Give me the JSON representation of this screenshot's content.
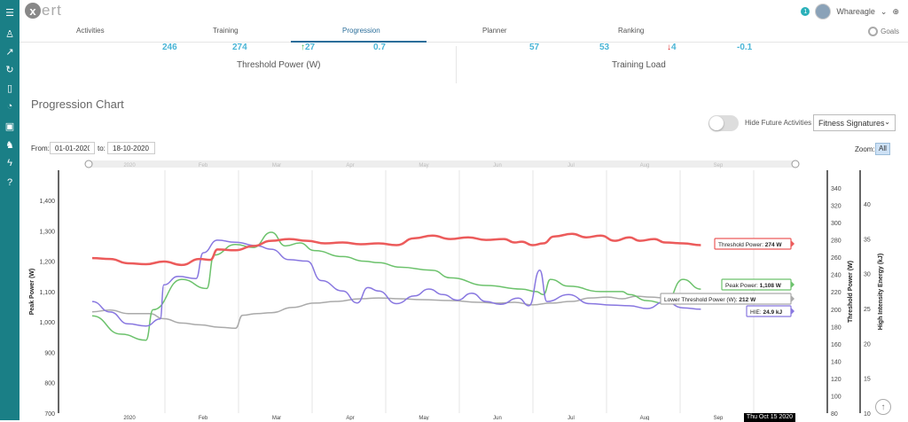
{
  "app": {
    "logo_letter": "x",
    "logo_text": "ert",
    "username": "Whareagle",
    "notifications": "1"
  },
  "sidebar": {
    "icons": [
      "menu-icon",
      "user-icon",
      "chart-icon",
      "refresh-icon",
      "phone-icon",
      "gauge-icon",
      "calendar-icon",
      "group-icon",
      "bolt-icon",
      "help-icon"
    ]
  },
  "tabs": [
    {
      "label": "Activities"
    },
    {
      "label": "Training"
    },
    {
      "label": "Progression"
    },
    {
      "label": "Planner"
    },
    {
      "label": "Ranking"
    }
  ],
  "goals_label": "Goals",
  "stats": {
    "threshold": {
      "values": [
        "246",
        "274",
        "27",
        "0.7"
      ],
      "label": "Threshold Power (W)"
    },
    "load": {
      "values": [
        "57",
        "53",
        "4",
        "-0.1"
      ],
      "label": "Training Load"
    }
  },
  "section_title": "Progression Chart",
  "controls": {
    "hide_future_label": "Hide Future Activities",
    "signature_select": "Fitness Signatures",
    "from_label": "From:",
    "from_value": "01-01-2020",
    "to_label": "to:",
    "to_value": "18-10-2020",
    "zoom_label": "Zoom:",
    "zoom_value": "All"
  },
  "colors": {
    "sidebar": "#1a7f86",
    "accent": "#4ab5d6",
    "threshold": "#ec5b5b",
    "peak": "#6cc26c",
    "lower": "#aaaaaa",
    "hie": "#8877e0"
  },
  "chart_data": {
    "type": "line",
    "x_month_labels": [
      "2020",
      "Feb",
      "Mar",
      "Apr",
      "May",
      "Jun",
      "Jul",
      "Aug",
      "Sep"
    ],
    "navigator_labels": [
      "2020",
      "Feb",
      "Mar",
      "Apr",
      "May",
      "Jun",
      "Jul",
      "Aug",
      "Sep"
    ],
    "y_left": {
      "label": "Peak Power (W)",
      "ticks": [
        "1,400",
        "1,300",
        "1,200",
        "1,100",
        "1,000",
        "900",
        "800",
        "700"
      ],
      "range": [
        700,
        1400
      ]
    },
    "y_right1": {
      "label": "Threshold Power (W)",
      "ticks": [
        "340",
        "320",
        "300",
        "280",
        "260",
        "240",
        "220",
        "200",
        "180",
        "160",
        "140",
        "120",
        "100",
        "80"
      ],
      "range": [
        80,
        340
      ]
    },
    "y_right2": {
      "label": "High Intensity Energy (kJ)",
      "ticks": [
        "40",
        "35",
        "30",
        "25",
        "20",
        "15",
        "10"
      ],
      "range": [
        10,
        40
      ]
    },
    "tooltip_date": "Thu Oct 15 2020",
    "series": [
      {
        "name": "Threshold Power",
        "last_label": "274 W",
        "axis": "right1",
        "points": [
          [
            0,
            259
          ],
          [
            0.5,
            258
          ],
          [
            1,
            253
          ],
          [
            1.5,
            252
          ],
          [
            2,
            255
          ],
          [
            2.5,
            251
          ],
          [
            3,
            258
          ],
          [
            3.3,
            257
          ],
          [
            3.5,
            269
          ],
          [
            4,
            268
          ],
          [
            4.5,
            273
          ],
          [
            5,
            279
          ],
          [
            5.5,
            281
          ],
          [
            6,
            279
          ],
          [
            6.5,
            276
          ],
          [
            7,
            277
          ],
          [
            7.5,
            275
          ],
          [
            8,
            276
          ],
          [
            8.5,
            274
          ],
          [
            9,
            282
          ],
          [
            9.5,
            285
          ],
          [
            10,
            281
          ],
          [
            10.5,
            283
          ],
          [
            11,
            280
          ],
          [
            11.5,
            281
          ],
          [
            11.8,
            277
          ],
          [
            12,
            278
          ],
          [
            12.3,
            274
          ],
          [
            12.6,
            276
          ],
          [
            12.9,
            284
          ],
          [
            13.4,
            287
          ],
          [
            13.8,
            283
          ],
          [
            14.2,
            285
          ],
          [
            14.6,
            279
          ],
          [
            15,
            283
          ],
          [
            15.3,
            279
          ],
          [
            15.7,
            281
          ],
          [
            16,
            277
          ],
          [
            16.5,
            276
          ],
          [
            17,
            274
          ]
        ]
      },
      {
        "name": "Peak Power",
        "last_label": "1,108 W",
        "axis": "left",
        "points": [
          [
            0,
            1020
          ],
          [
            0.8,
            960
          ],
          [
            1.5,
            940
          ],
          [
            1.7,
            1040
          ],
          [
            2.5,
            1140
          ],
          [
            3.2,
            1110
          ],
          [
            3.4,
            1220
          ],
          [
            4,
            1255
          ],
          [
            4.5,
            1245
          ],
          [
            5,
            1295
          ],
          [
            5.4,
            1250
          ],
          [
            5.8,
            1260
          ],
          [
            6.2,
            1235
          ],
          [
            7,
            1215
          ],
          [
            7.6,
            1200
          ],
          [
            8,
            1195
          ],
          [
            8.6,
            1180
          ],
          [
            9.5,
            1170
          ],
          [
            10,
            1145
          ],
          [
            11,
            1120
          ],
          [
            12,
            1108
          ],
          [
            12.4,
            1100
          ],
          [
            12.6,
            1090
          ],
          [
            12.8,
            1140
          ],
          [
            13.3,
            1118
          ],
          [
            14.2,
            1100
          ],
          [
            14.8,
            1100
          ],
          [
            15,
            1090
          ],
          [
            15.5,
            1070
          ],
          [
            16,
            1060
          ],
          [
            16.5,
            1140
          ],
          [
            17,
            1108
          ]
        ]
      },
      {
        "name": "Lower Threshold Power (W)",
        "last_label": "212 W",
        "axis": "right1",
        "points": [
          [
            0,
            197
          ],
          [
            0.5,
            199
          ],
          [
            1,
            195
          ],
          [
            1.6,
            195
          ],
          [
            2,
            189
          ],
          [
            2.5,
            184
          ],
          [
            3,
            182
          ],
          [
            3.6,
            179
          ],
          [
            4,
            178
          ],
          [
            4.2,
            193
          ],
          [
            4.6,
            195
          ],
          [
            5,
            196
          ],
          [
            5.6,
            202
          ],
          [
            6.2,
            207
          ],
          [
            6.8,
            209
          ],
          [
            7.5,
            212
          ],
          [
            8,
            213
          ],
          [
            8.6,
            212
          ],
          [
            9.2,
            211
          ],
          [
            10,
            210
          ],
          [
            10.8,
            208
          ],
          [
            11.3,
            207
          ],
          [
            11.8,
            208
          ],
          [
            12.3,
            205
          ],
          [
            12.8,
            207
          ],
          [
            13.4,
            209
          ],
          [
            13.9,
            213
          ],
          [
            14.4,
            214
          ],
          [
            14.8,
            212
          ],
          [
            15.2,
            215
          ],
          [
            15.6,
            214
          ],
          [
            16,
            213
          ],
          [
            16.5,
            213
          ],
          [
            17,
            212
          ]
        ]
      },
      {
        "name": "HIE",
        "last_label": "24.9 kJ",
        "axis": "right2",
        "points": [
          [
            0,
            26.0
          ],
          [
            0.5,
            24.5
          ],
          [
            1,
            22.8
          ],
          [
            1.5,
            22.5
          ],
          [
            1.9,
            23.5
          ],
          [
            2,
            28.4
          ],
          [
            2.4,
            29.6
          ],
          [
            2.9,
            29.3
          ],
          [
            3.1,
            33.0
          ],
          [
            3.5,
            34.8
          ],
          [
            4,
            34.5
          ],
          [
            4.6,
            34.0
          ],
          [
            5,
            33.5
          ],
          [
            5.5,
            32.0
          ],
          [
            6,
            31.8
          ],
          [
            6.4,
            29.0
          ],
          [
            7,
            27.5
          ],
          [
            7.4,
            25.8
          ],
          [
            7.7,
            28.0
          ],
          [
            8,
            27.5
          ],
          [
            8.5,
            25.7
          ],
          [
            9,
            26.8
          ],
          [
            9.4,
            27.8
          ],
          [
            9.8,
            27.0
          ],
          [
            10.2,
            26.2
          ],
          [
            10.6,
            27.2
          ],
          [
            11,
            26.0
          ],
          [
            11.4,
            25.6
          ],
          [
            11.9,
            26.5
          ],
          [
            12.2,
            25.4
          ],
          [
            12.5,
            30.5
          ],
          [
            12.7,
            26.0
          ],
          [
            13.3,
            27.0
          ],
          [
            13.9,
            25.7
          ],
          [
            14.5,
            25.5
          ],
          [
            15,
            25.4
          ],
          [
            15.5,
            25.0
          ],
          [
            16,
            26.0
          ],
          [
            16.5,
            25.1
          ],
          [
            17,
            24.9
          ]
        ]
      }
    ]
  }
}
